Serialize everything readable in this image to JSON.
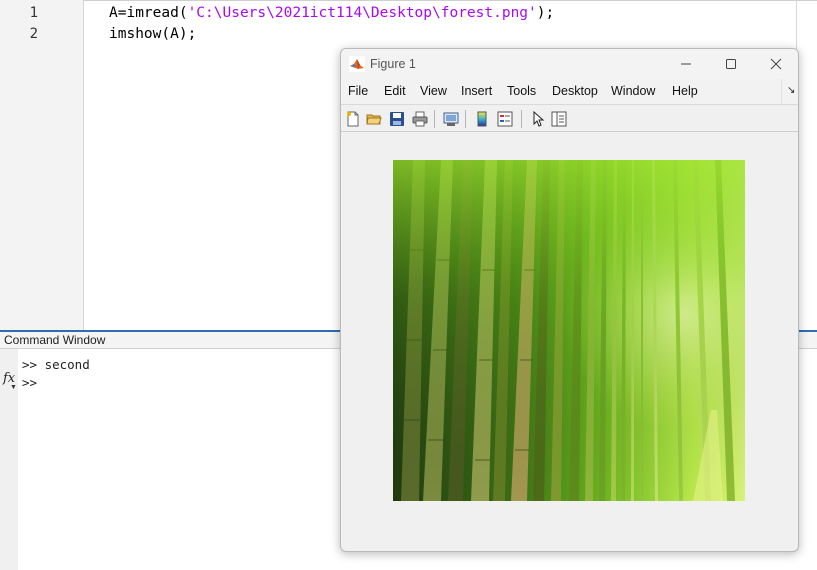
{
  "editor": {
    "lines": [
      {
        "number": "1",
        "code_prefix": "A=imread(",
        "code_string": "'C:\\Users\\2021ict114\\Desktop\\forest.png'",
        "code_suffix": ");"
      },
      {
        "number": "2",
        "code_prefix": "imshow(A);",
        "code_string": "",
        "code_suffix": ""
      }
    ],
    "string_color": "#a709f5"
  },
  "command_window": {
    "title": "Command Window",
    "fx_label": "fx",
    "lines": [
      ">> second",
      ">>"
    ]
  },
  "figure": {
    "title": "Figure 1",
    "window_buttons": [
      "minimize-icon",
      "maximize-icon",
      "close-icon"
    ],
    "menu": [
      "File",
      "Edit",
      "View",
      "Insert",
      "Tools",
      "Desktop",
      "Window",
      "Help"
    ],
    "dock_icon": "dock-arrow-icon",
    "toolbar": [
      "new-figure-icon",
      "open-file-icon",
      "save-icon",
      "print-icon",
      "link-plot-icon",
      "insert-colorbar-icon",
      "insert-legend-icon",
      "edit-plot-cursor-icon",
      "property-inspector-icon"
    ],
    "image_subject": "bamboo-forest-image",
    "accent": "#2f6cb5"
  }
}
